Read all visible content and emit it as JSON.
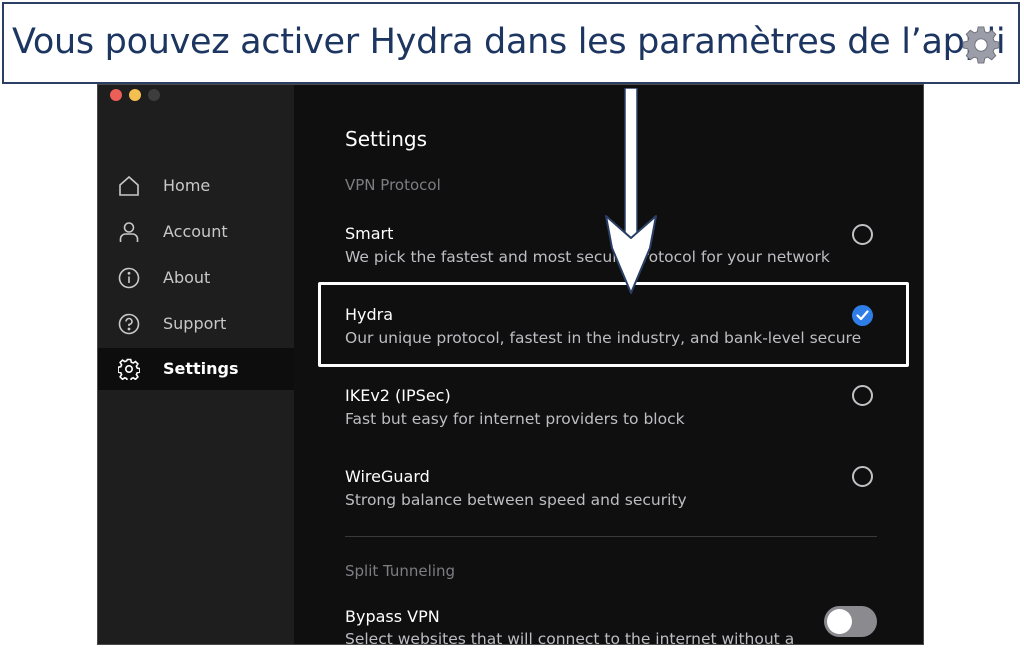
{
  "banner": {
    "text": "Vous pouvez activer Hydra dans les paramètres de l’appli",
    "icon": "gear-icon"
  },
  "sidebar": {
    "items": [
      {
        "label": "Home",
        "icon": "home-icon",
        "active": false
      },
      {
        "label": "Account",
        "icon": "user-icon",
        "active": false
      },
      {
        "label": "About",
        "icon": "info-icon",
        "active": false
      },
      {
        "label": "Support",
        "icon": "help-icon",
        "active": false
      },
      {
        "label": "Settings",
        "icon": "gear-icon",
        "active": true
      }
    ]
  },
  "settings": {
    "title": "Settings",
    "vpn_protocol_label": "VPN Protocol",
    "options": [
      {
        "title": "Smart",
        "description": "We pick the fastest and most secure protocol for your network",
        "selected": false
      },
      {
        "title": "Hydra",
        "description": "Our unique protocol, fastest in the industry, and bank-level secure",
        "selected": true
      },
      {
        "title": "IKEv2 (IPSec)",
        "description": "Fast but easy for internet providers to block",
        "selected": false
      },
      {
        "title": "WireGuard",
        "description": "Strong balance between speed and security",
        "selected": false
      }
    ],
    "split_tunneling_label": "Split Tunneling",
    "bypass": {
      "title": "Bypass VPN",
      "description": "Select websites that will connect to the internet without a",
      "enabled": false
    }
  },
  "colors": {
    "banner_text": "#1c3561",
    "accent": "#2f7ee8",
    "window_bg": "#0f0f10",
    "sidebar_bg": "#1e1e1f"
  }
}
